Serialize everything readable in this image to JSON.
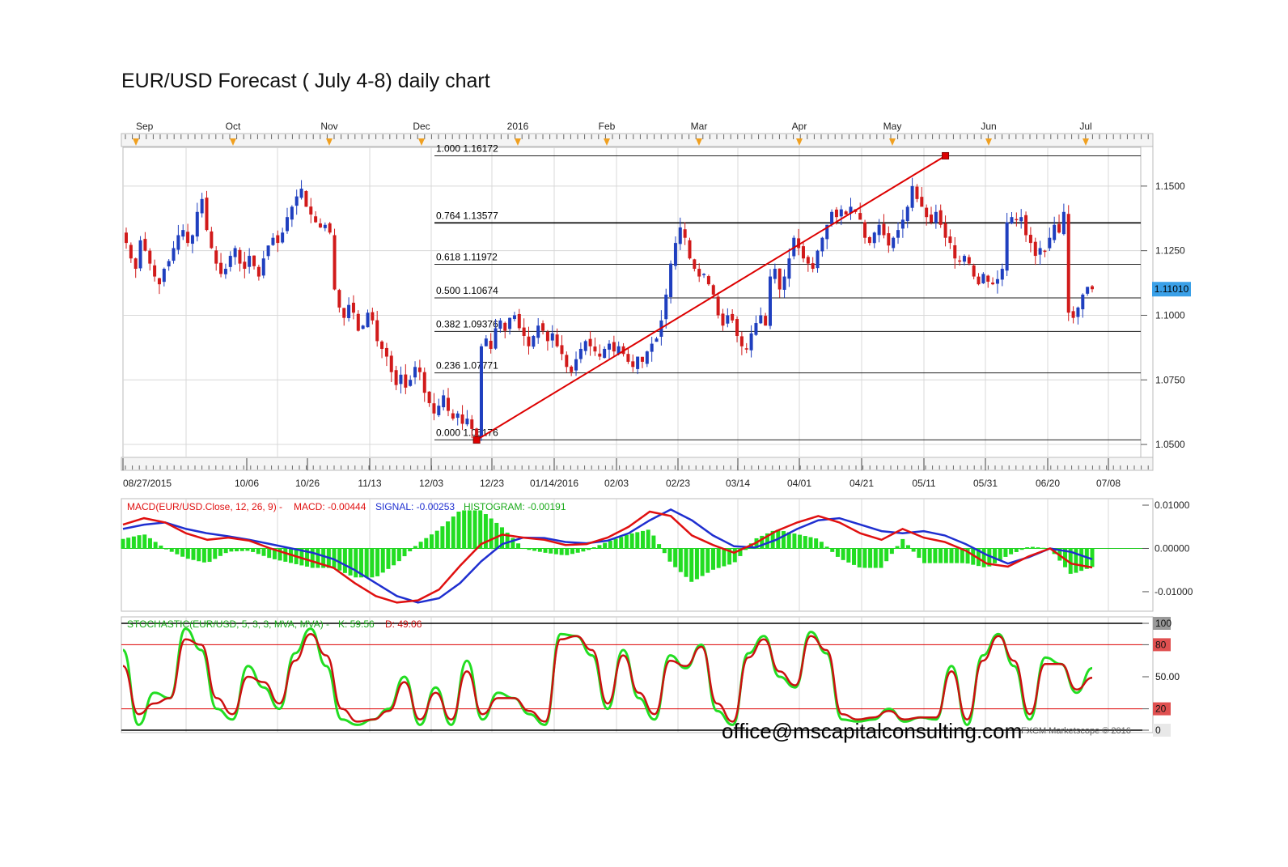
{
  "title": "EUR/USD Forecast ( July 4-8) daily chart",
  "watermark": "office@mscapitalconsulting.com",
  "copyright": "FXCM Marketscope © 2016",
  "colors": {
    "bull": "#1f3fbf",
    "bear": "#d11a1a",
    "grid": "#d8d8d8",
    "macd": "#e01010",
    "signal": "#1f2fd0",
    "histogram": "#22dd22",
    "stoch_k": "#22dd22",
    "stoch_d": "#cc1111",
    "price_tag": "#3aa0e8"
  },
  "chart_data": [
    {
      "type": "candlestick",
      "series": [
        {
          "name": "EUR/USD"
        }
      ],
      "month_labels": [
        "Sep",
        "Oct",
        "Nov",
        "Dec",
        "2016",
        "Feb",
        "Mar",
        "Apr",
        "May",
        "Jun",
        "Jul"
      ],
      "date_labels": [
        "08/27/2015",
        "10/06",
        "10/26",
        "11/13",
        "12/03",
        "12/23",
        "01/14/2016",
        "02/03",
        "02/23",
        "03/14",
        "04/01",
        "04/21",
        "05/11",
        "05/31",
        "06/20",
        "07/08"
      ],
      "y_ticks": [
        "1.0500",
        "1.0750",
        "1.1000",
        "1.1250",
        "1.1500"
      ],
      "ylim": [
        1.045,
        1.165
      ],
      "last_price": "1.11010",
      "fibonacci": [
        {
          "label": "1.000 1.16172",
          "value": 1.16172
        },
        {
          "label": "0.764 1.13577",
          "value": 1.13577
        },
        {
          "label": "0.618 1.11972",
          "value": 1.11972
        },
        {
          "label": "0.500 1.10674",
          "value": 1.10674
        },
        {
          "label": "0.382 1.09376",
          "value": 1.09376
        },
        {
          "label": "0.236 1.07771",
          "value": 1.07771
        },
        {
          "label": "0.000 1.05176",
          "value": 1.05176
        }
      ],
      "trendline": {
        "from": 1.05176,
        "to": 1.16172
      },
      "ohlc_closes": [
        1.128,
        1.122,
        1.118,
        1.129,
        1.125,
        1.12,
        1.115,
        1.112,
        1.118,
        1.121,
        1.126,
        1.131,
        1.133,
        1.128,
        1.131,
        1.14,
        1.145,
        1.133,
        1.126,
        1.12,
        1.116,
        1.118,
        1.123,
        1.126,
        1.12,
        1.118,
        1.123,
        1.119,
        1.115,
        1.122,
        1.127,
        1.13,
        1.128,
        1.132,
        1.138,
        1.142,
        1.146,
        1.149,
        1.142,
        1.139,
        1.136,
        1.134,
        1.135,
        1.132,
        1.11,
        1.103,
        1.099,
        1.104,
        1.101,
        1.094,
        1.096,
        1.101,
        1.098,
        1.09,
        1.087,
        1.084,
        1.078,
        1.073,
        1.077,
        1.072,
        1.075,
        1.08,
        1.078,
        1.07,
        1.066,
        1.062,
        1.065,
        1.069,
        1.063,
        1.06,
        1.062,
        1.058,
        1.06,
        1.056,
        1.053,
        1.088,
        1.091,
        1.087,
        1.095,
        1.098,
        1.094,
        1.099,
        1.1,
        1.095,
        1.092,
        1.088,
        1.092,
        1.096,
        1.094,
        1.09,
        1.093,
        1.088,
        1.085,
        1.08,
        1.078,
        1.083,
        1.087,
        1.09,
        1.088,
        1.086,
        1.084,
        1.087,
        1.089,
        1.086,
        1.088,
        1.085,
        1.082,
        1.08,
        1.084,
        1.082,
        1.086,
        1.089,
        1.091,
        1.098,
        1.108,
        1.12,
        1.128,
        1.134,
        1.13,
        1.122,
        1.118,
        1.115,
        1.116,
        1.112,
        1.108,
        1.1,
        1.096,
        1.1,
        1.098,
        1.092,
        1.088,
        1.087,
        1.093,
        1.097,
        1.1,
        1.096,
        1.115,
        1.118,
        1.11,
        1.115,
        1.122,
        1.13,
        1.126,
        1.122,
        1.12,
        1.118,
        1.125,
        1.13,
        1.135,
        1.14,
        1.138,
        1.141,
        1.139,
        1.142,
        1.14,
        1.137,
        1.13,
        1.128,
        1.132,
        1.135,
        1.131,
        1.127,
        1.13,
        1.133,
        1.137,
        1.142,
        1.15,
        1.145,
        1.142,
        1.138,
        1.136,
        1.14,
        1.135,
        1.13,
        1.128,
        1.122,
        1.121,
        1.123,
        1.12,
        1.115,
        1.112,
        1.116,
        1.113,
        1.112,
        1.114,
        1.118,
        1.136,
        1.138,
        1.137,
        1.138,
        1.131,
        1.128,
        1.123,
        1.126,
        1.125,
        1.13,
        1.135,
        1.132,
        1.14,
        1.101,
        1.099,
        1.103,
        1.108,
        1.111,
        1.1101
      ]
    },
    {
      "type": "line",
      "title": "MACD(EUR/USD.Close, 12, 26, 9) -",
      "readouts": [
        {
          "name": "MACD",
          "text": "MACD: -0.00444"
        },
        {
          "name": "SIGNAL",
          "text": "SIGNAL: -0.00253"
        },
        {
          "name": "HISTOGRAM",
          "text": "HISTOGRAM: -0.00191"
        }
      ],
      "y_ticks": [
        "0.01000",
        "0.00000",
        "-0.01000"
      ],
      "ylim": [
        -0.0145,
        0.0115
      ],
      "series": [
        {
          "name": "MACD",
          "values": [
            0.0055,
            0.007,
            0.006,
            0.0035,
            0.002,
            0.0025,
            0.0018,
            0.0,
            -0.0015,
            -0.003,
            -0.0045,
            -0.008,
            -0.011,
            -0.0125,
            -0.012,
            -0.0095,
            -0.004,
            0.001,
            0.0032,
            0.0025,
            0.002,
            0.0008,
            0.001,
            0.0025,
            0.005,
            0.0085,
            0.0075,
            0.003,
            0.0008,
            -0.001,
            0.0012,
            0.004,
            0.006,
            0.0075,
            0.006,
            0.0035,
            0.002,
            0.0045,
            0.0025,
            0.0015,
            -0.0005,
            -0.0035,
            -0.0042,
            -0.0018,
            0.0,
            -0.0035,
            -0.0044
          ]
        },
        {
          "name": "SIGNAL",
          "values": [
            0.0045,
            0.0055,
            0.006,
            0.0045,
            0.0035,
            0.0028,
            0.002,
            0.001,
            0.0,
            -0.001,
            -0.0025,
            -0.005,
            -0.008,
            -0.011,
            -0.0125,
            -0.0115,
            -0.008,
            -0.003,
            0.001,
            0.0025,
            0.0024,
            0.0015,
            0.0012,
            0.0018,
            0.0035,
            0.0065,
            0.009,
            0.0065,
            0.003,
            0.0005,
            0.0002,
            0.002,
            0.0045,
            0.0065,
            0.007,
            0.0055,
            0.004,
            0.0035,
            0.004,
            0.003,
            0.001,
            -0.0015,
            -0.0035,
            -0.002,
            0.0,
            -0.0008,
            -0.0025
          ]
        }
      ]
    },
    {
      "type": "line",
      "title": "STOCHASTIC(EUR/USD, 5, 3, 3, MVA, MVA) -",
      "readouts": [
        {
          "name": "K",
          "text": "K: 59.56"
        },
        {
          "name": "D",
          "text": "D: 49.06"
        }
      ],
      "y_ticks": [
        "100",
        "80",
        "50.00",
        "20",
        "0"
      ],
      "ylim": [
        0,
        100
      ],
      "series": [
        {
          "name": "K",
          "values": [
            75,
            5,
            35,
            30,
            95,
            75,
            20,
            10,
            60,
            40,
            20,
            72,
            95,
            60,
            10,
            5,
            10,
            20,
            50,
            5,
            40,
            5,
            65,
            10,
            35,
            30,
            15,
            5,
            90,
            88,
            70,
            20,
            75,
            30,
            10,
            70,
            58,
            80,
            18,
            5,
            72,
            88,
            50,
            40,
            92,
            72,
            10,
            8,
            10,
            20,
            8,
            12,
            10,
            60,
            5,
            70,
            90,
            60,
            10,
            68,
            62,
            35,
            58
          ]
        },
        {
          "name": "D",
          "values": [
            60,
            15,
            25,
            30,
            85,
            80,
            30,
            15,
            50,
            45,
            25,
            65,
            90,
            70,
            20,
            8,
            10,
            18,
            45,
            10,
            35,
            10,
            55,
            15,
            30,
            30,
            18,
            8,
            85,
            88,
            75,
            25,
            70,
            35,
            15,
            65,
            60,
            78,
            25,
            8,
            68,
            85,
            55,
            42,
            88,
            75,
            15,
            10,
            12,
            18,
            10,
            12,
            12,
            55,
            10,
            65,
            88,
            65,
            15,
            62,
            62,
            38,
            49
          ]
        }
      ]
    }
  ]
}
